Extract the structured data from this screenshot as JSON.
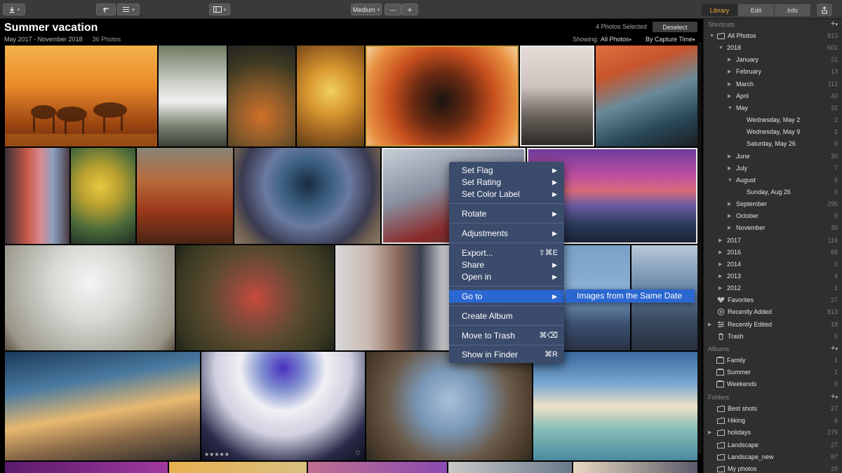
{
  "toolbar": {
    "import_icon": "download-icon",
    "rotate_icon": "rotate-icon",
    "sort_icon": "list-icon",
    "panel_icon": "sidebar-panel-icon",
    "size_label": "Medium",
    "zoom_out": "—",
    "zoom_in": "+"
  },
  "header": {
    "title": "Summer vacation",
    "date_range": "May 2017 - November 2018",
    "photo_count": "36 Photos",
    "selected": "4 Photos Selected",
    "deselect": "Deselect",
    "showing_label": "Showing:",
    "showing_value": "All Photos",
    "sort_value": "By Capture Time"
  },
  "tabs": [
    "Library",
    "Edit",
    "Info"
  ],
  "context_menu": {
    "items": [
      {
        "label": "Set Flag",
        "shortcut": "",
        "arrow": "▶"
      },
      {
        "label": "Set Rating",
        "shortcut": "",
        "arrow": "▶"
      },
      {
        "label": "Set Color Label",
        "shortcut": "",
        "arrow": "▶"
      },
      {
        "label": "Rotate",
        "shortcut": "",
        "arrow": "▶"
      },
      {
        "label": "Adjustments",
        "shortcut": "",
        "arrow": "▶"
      },
      {
        "label": "Export...",
        "shortcut": "⇧⌘E",
        "arrow": ""
      },
      {
        "label": "Share",
        "shortcut": "",
        "arrow": "▶"
      },
      {
        "label": "Open in",
        "shortcut": "",
        "arrow": "▶"
      },
      {
        "label": "Go to",
        "shortcut": "",
        "arrow": "▶"
      },
      {
        "label": "Create Album",
        "shortcut": "",
        "arrow": ""
      },
      {
        "label": "Move to Trash",
        "shortcut": "⌘⌫",
        "arrow": ""
      },
      {
        "label": "Show in Finder",
        "shortcut": "⌘R",
        "arrow": ""
      }
    ],
    "submenu": "Images from the Same Date"
  },
  "sidebar": {
    "shortcuts_header": "Shortcuts",
    "albums_header": "Albums",
    "folders_header": "Folders",
    "shortcuts": [
      {
        "label": "All Photos",
        "count": "813"
      },
      {
        "label": "2018",
        "count": "601"
      },
      {
        "label": "January",
        "count": "22"
      },
      {
        "label": "February",
        "count": "13"
      },
      {
        "label": "March",
        "count": "112"
      },
      {
        "label": "April",
        "count": "40"
      },
      {
        "label": "May",
        "count": "32"
      },
      {
        "label": "Wednesday, May 2",
        "count": "2"
      },
      {
        "label": "Wednesday, May 9",
        "count": "2"
      },
      {
        "label": "Saturday, May 26",
        "count": "6"
      },
      {
        "label": "June",
        "count": "30"
      },
      {
        "label": "July",
        "count": "7"
      },
      {
        "label": "August",
        "count": "6"
      },
      {
        "label": "Sunday, Aug 26",
        "count": "6"
      },
      {
        "label": "September",
        "count": "295"
      },
      {
        "label": "October",
        "count": "5"
      },
      {
        "label": "November",
        "count": "39"
      },
      {
        "label": "2017",
        "count": "116"
      },
      {
        "label": "2016",
        "count": "88"
      },
      {
        "label": "2014",
        "count": "3"
      },
      {
        "label": "2013",
        "count": "4"
      },
      {
        "label": "2012",
        "count": "1"
      },
      {
        "label": "Favorites",
        "count": "27"
      },
      {
        "label": "Recently Added",
        "count": "813"
      },
      {
        "label": "Recently Edited",
        "count": "18"
      },
      {
        "label": "Trash",
        "count": "5"
      }
    ],
    "albums": [
      {
        "label": "Family",
        "count": "1"
      },
      {
        "label": "Summer",
        "count": "1"
      },
      {
        "label": "Weekends",
        "count": "5"
      }
    ],
    "folders": [
      {
        "label": "Best shots",
        "count": "27"
      },
      {
        "label": "Hiking",
        "count": "6"
      },
      {
        "label": "holidays",
        "count": "279"
      },
      {
        "label": "Landscape",
        "count": "27"
      },
      {
        "label": "Landscape_new",
        "count": "87"
      },
      {
        "label": "My photos",
        "count": "29"
      }
    ]
  },
  "colors": {
    "accent": "#f2a33a",
    "selection": "#c99b3e",
    "menu_bg": "#3b4b6c",
    "menu_highlight": "#2b67d0"
  }
}
